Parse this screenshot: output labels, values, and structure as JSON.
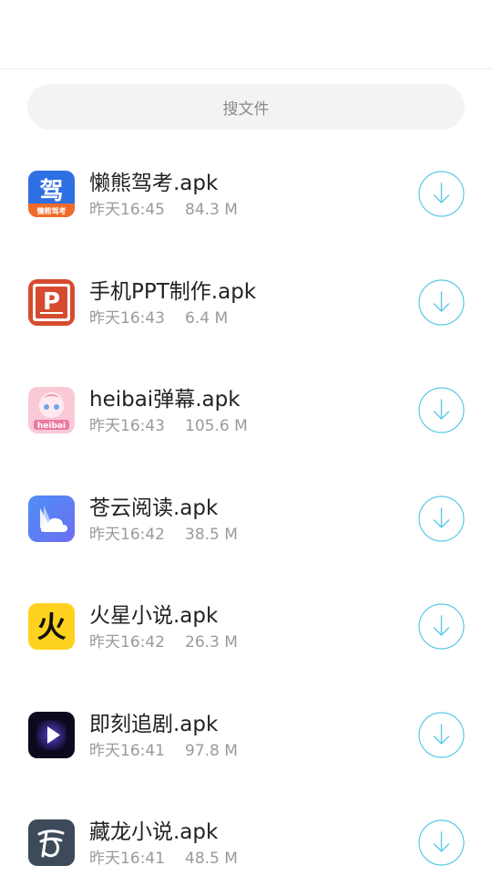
{
  "search": {
    "placeholder": "搜文件"
  },
  "accent_color": "#5bc8e8",
  "files": [
    {
      "name": "懒熊驾考.apk",
      "time": "昨天16:45",
      "size": "84.3 M",
      "icon": "lanxiong-jiakao-app-icon",
      "icon_glyph": "驾",
      "icon_caption": "懒熊驾考"
    },
    {
      "name": "手机PPT制作.apk",
      "time": "昨天16:43",
      "size": "6.4 M",
      "icon": "ppt-app-icon",
      "icon_glyph": "P"
    },
    {
      "name": "heibai弹幕.apk",
      "time": "昨天16:43",
      "size": "105.6 M",
      "icon": "heibai-danmu-app-icon",
      "icon_caption": "heibai"
    },
    {
      "name": "苍云阅读.apk",
      "time": "昨天16:42",
      "size": "38.5 M",
      "icon": "cangyun-yuedu-app-icon"
    },
    {
      "name": "火星小说.apk",
      "time": "昨天16:42",
      "size": "26.3 M",
      "icon": "huoxing-xiaoshuo-app-icon",
      "icon_glyph": "火"
    },
    {
      "name": "即刻追剧.apk",
      "time": "昨天16:41",
      "size": "97.8 M",
      "icon": "jike-zhuiju-app-icon"
    },
    {
      "name": "藏龙小说.apk",
      "time": "昨天16:41",
      "size": "48.5 M",
      "icon": "canglong-xiaoshuo-app-icon"
    }
  ]
}
